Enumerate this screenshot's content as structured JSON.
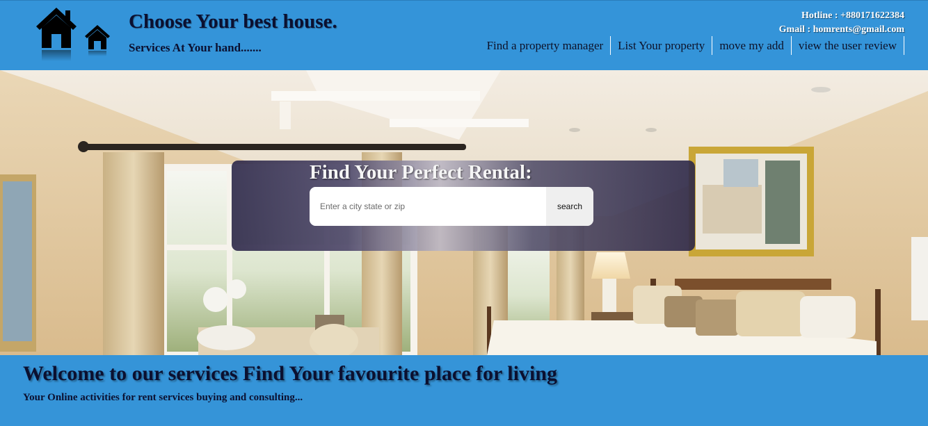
{
  "header": {
    "title": "Choose Your best house.",
    "subtitle": "Services At Your hand.......",
    "hotline": "Hotline : +880171622384",
    "gmail": "Gmail : homrents@gmail.com",
    "nav": [
      {
        "label": "Find a property manager"
      },
      {
        "label": "List Your property"
      },
      {
        "label": "move my add"
      },
      {
        "label": "view the user review"
      }
    ]
  },
  "hero": {
    "search_title": "Find Your Perfect Rental:",
    "search_placeholder": "Enter a city state or zip",
    "search_value": "",
    "search_button": "search"
  },
  "welcome": {
    "title": "Welcome to our services Find Your favourite place for living",
    "subtitle": "Your Online activities for rent services buying and consulting..."
  },
  "colors": {
    "header_bg": "#3494d9",
    "welcome_bg": "#3594d8",
    "text_dark": "#0b1030"
  },
  "icons": [
    "house-logo-icon",
    "small-house-icon"
  ]
}
